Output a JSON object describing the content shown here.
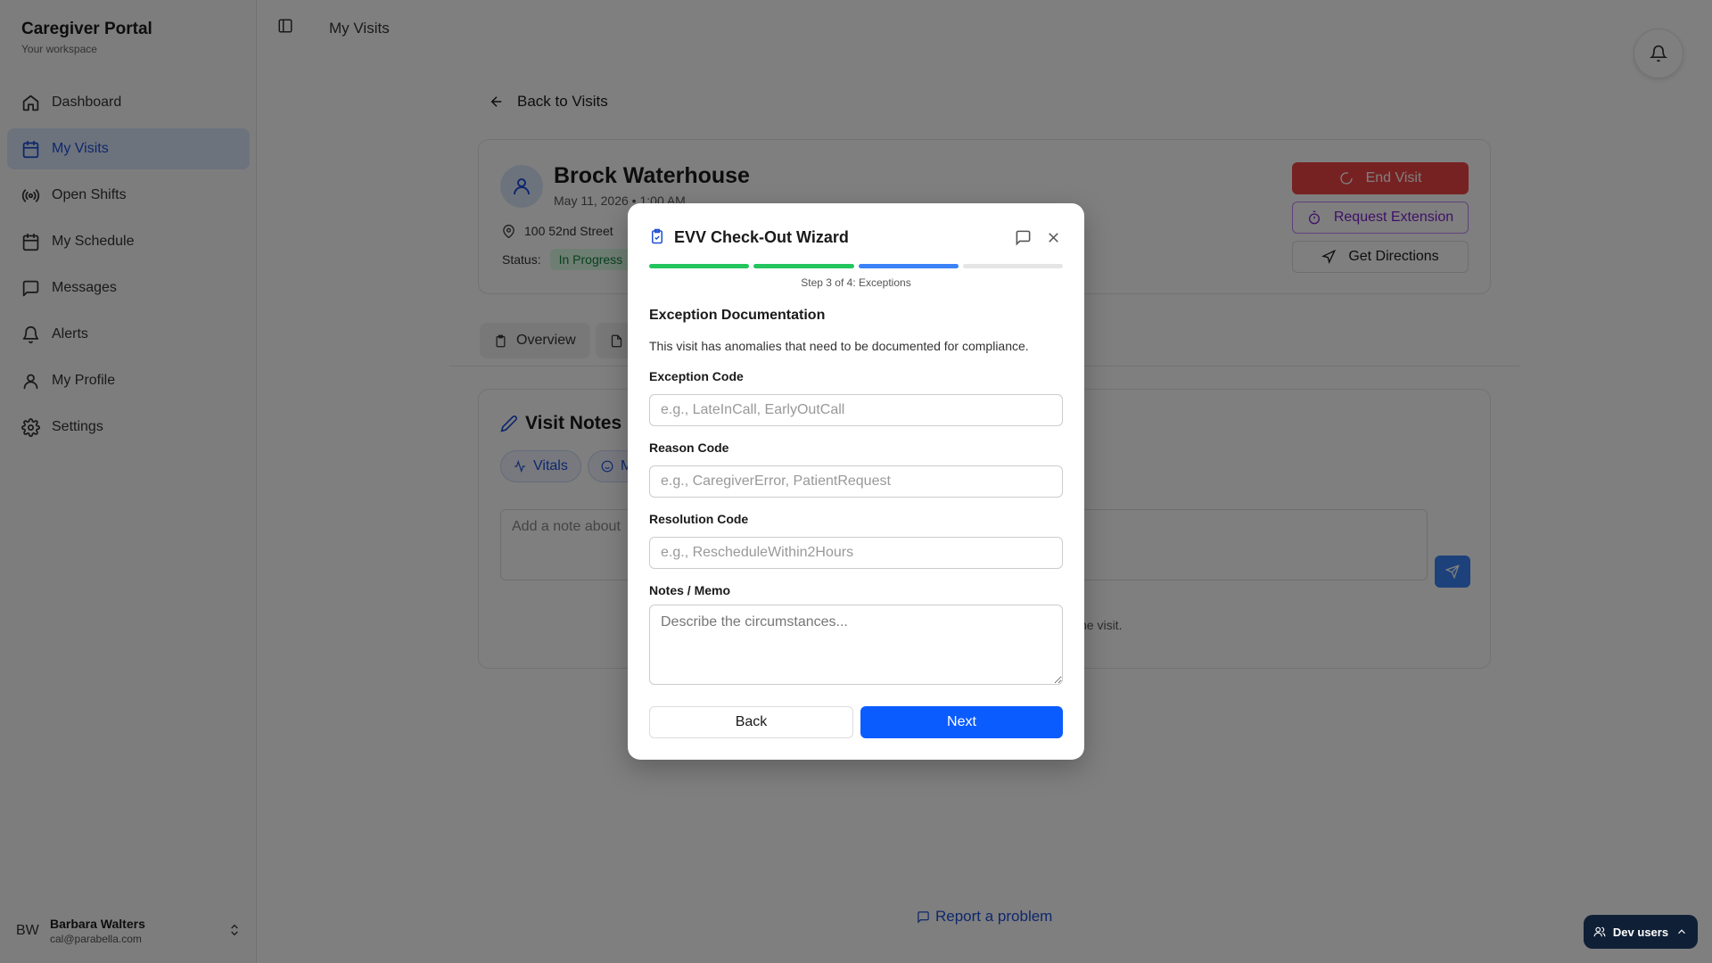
{
  "brand": {
    "title": "Caregiver Portal",
    "subtitle": "Your workspace"
  },
  "sidebar": {
    "items": [
      {
        "label": "Dashboard",
        "icon": "home-icon",
        "active": false
      },
      {
        "label": "My Visits",
        "icon": "calendar-icon",
        "active": true
      },
      {
        "label": "Open Shifts",
        "icon": "broadcast-icon",
        "active": false
      },
      {
        "label": "My Schedule",
        "icon": "calendar-icon",
        "active": false
      },
      {
        "label": "Messages",
        "icon": "message-icon",
        "active": false
      },
      {
        "label": "Alerts",
        "icon": "bell-icon",
        "active": false
      },
      {
        "label": "My Profile",
        "icon": "user-icon",
        "active": false
      },
      {
        "label": "Settings",
        "icon": "gear-icon",
        "active": false
      }
    ],
    "user": {
      "initials": "BW",
      "name": "Barbara Walters",
      "email": "cal@parabella.com"
    }
  },
  "topbar": {
    "title": "My Visits"
  },
  "main": {
    "back_label": "Back to Visits",
    "visit": {
      "patient_name": "Brock Waterhouse",
      "datetime": "May 11, 2026 • 1:00 AM",
      "address": "100 52nd Street",
      "status_label": "Status:",
      "status_value": "In Progress",
      "actions": {
        "end_visit": "End Visit",
        "request_extension": "Request Extension",
        "get_directions": "Get Directions"
      }
    },
    "tabs": [
      "Overview",
      ""
    ],
    "notes": {
      "title": "Visit Notes",
      "chips": [
        "Vitals",
        "M"
      ],
      "placeholder": "Add a note about",
      "empty_text": "ne visit."
    },
    "report_label": "Report a problem",
    "dev_users_label": "Dev users"
  },
  "modal": {
    "title": "EVV Check-Out Wizard",
    "step_label": "Step 3 of 4: Exceptions",
    "progress": {
      "current_step": 3,
      "total_steps": 4
    },
    "section_title": "Exception Documentation",
    "section_desc": "This visit has anomalies that need to be documented for compliance.",
    "fields": {
      "exception_code": {
        "label": "Exception Code",
        "placeholder": "e.g., LateInCall, EarlyOutCall",
        "value": ""
      },
      "reason_code": {
        "label": "Reason Code",
        "placeholder": "e.g., CaregiverError, PatientRequest",
        "value": ""
      },
      "resolution_code": {
        "label": "Resolution Code",
        "placeholder": "e.g., RescheduleWithin2Hours",
        "value": ""
      },
      "notes": {
        "label": "Notes / Memo",
        "placeholder": "Describe the circumstances...",
        "value": ""
      }
    },
    "back_label": "Back",
    "next_label": "Next"
  },
  "colors": {
    "accent": "#1d4ed8",
    "primary_button": "#0b5cff",
    "progress_done": "#22c55e",
    "progress_current": "#3b82f6",
    "end_visit": "#ef4444",
    "extension": "#7e22ce"
  }
}
